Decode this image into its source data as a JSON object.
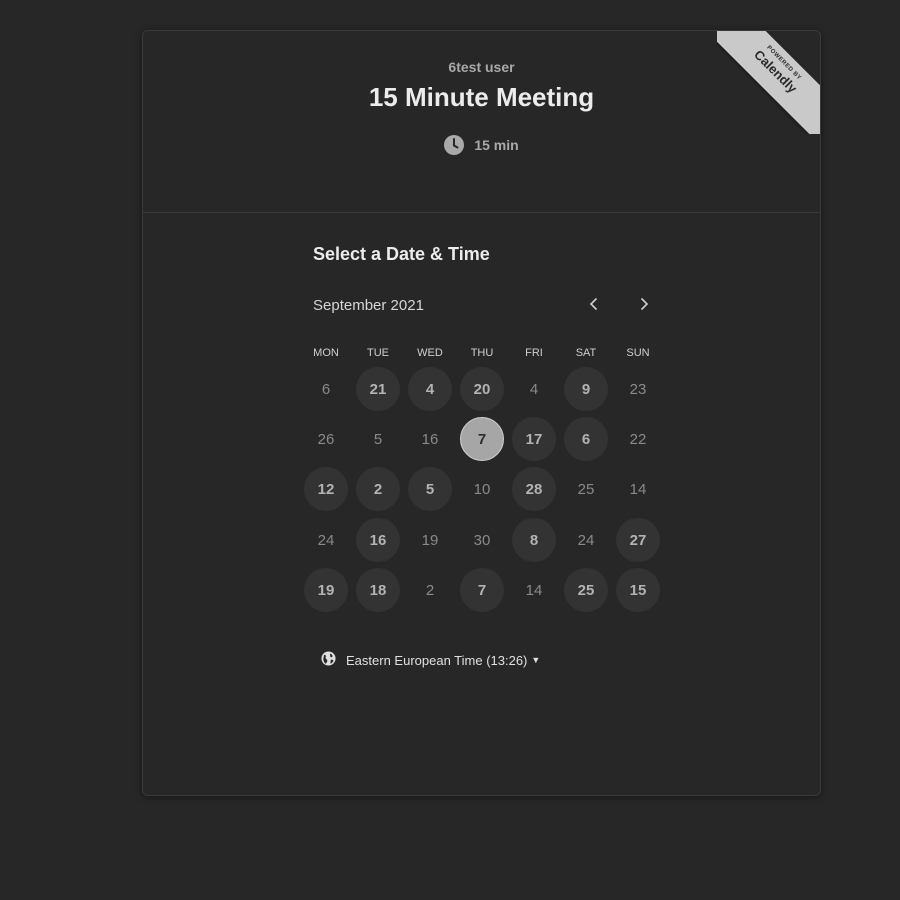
{
  "header": {
    "host_name": "6test user",
    "event_title": "15 Minute Meeting",
    "duration": "15 min"
  },
  "ribbon": {
    "powered_by": "POWERED BY",
    "brand": "Calendly"
  },
  "scheduler": {
    "title": "Select a Date & Time",
    "month": "September 2021",
    "weekdays": [
      "MON",
      "TUE",
      "WED",
      "THU",
      "FRI",
      "SAT",
      "SUN"
    ],
    "weeks": [
      [
        {
          "label": "6",
          "state": "unavailable"
        },
        {
          "label": "21",
          "state": "available"
        },
        {
          "label": "4",
          "state": "available"
        },
        {
          "label": "20",
          "state": "available"
        },
        {
          "label": "4",
          "state": "unavailable"
        },
        {
          "label": "9",
          "state": "available"
        },
        {
          "label": "23",
          "state": "unavailable"
        }
      ],
      [
        {
          "label": "26",
          "state": "unavailable"
        },
        {
          "label": "5",
          "state": "unavailable"
        },
        {
          "label": "16",
          "state": "unavailable"
        },
        {
          "label": "7",
          "state": "selected"
        },
        {
          "label": "17",
          "state": "available"
        },
        {
          "label": "6",
          "state": "available"
        },
        {
          "label": "22",
          "state": "unavailable"
        }
      ],
      [
        {
          "label": "12",
          "state": "available"
        },
        {
          "label": "2",
          "state": "available"
        },
        {
          "label": "5",
          "state": "available"
        },
        {
          "label": "10",
          "state": "unavailable"
        },
        {
          "label": "28",
          "state": "available"
        },
        {
          "label": "25",
          "state": "unavailable"
        },
        {
          "label": "14",
          "state": "unavailable"
        }
      ],
      [
        {
          "label": "24",
          "state": "unavailable"
        },
        {
          "label": "16",
          "state": "available"
        },
        {
          "label": "19",
          "state": "unavailable"
        },
        {
          "label": "30",
          "state": "unavailable"
        },
        {
          "label": "8",
          "state": "available"
        },
        {
          "label": "24",
          "state": "unavailable"
        },
        {
          "label": "27",
          "state": "available"
        }
      ],
      [
        {
          "label": "19",
          "state": "available"
        },
        {
          "label": "18",
          "state": "available"
        },
        {
          "label": "2",
          "state": "unavailable"
        },
        {
          "label": "7",
          "state": "available"
        },
        {
          "label": "14",
          "state": "unavailable"
        },
        {
          "label": "25",
          "state": "available"
        },
        {
          "label": "15",
          "state": "available"
        }
      ]
    ]
  },
  "timezone": {
    "label": "Eastern European Time (13:26)"
  },
  "icons": {
    "duration": "clock-icon",
    "prev": "chevron-left-icon",
    "next": "chevron-right-icon",
    "timezone": "globe-icon",
    "dropdown": "caret-down-icon"
  },
  "colors": {
    "background": "#272727",
    "available_day": "#333333",
    "selected_day": "#a6a6a6",
    "ribbon": "#c9c9c9"
  }
}
